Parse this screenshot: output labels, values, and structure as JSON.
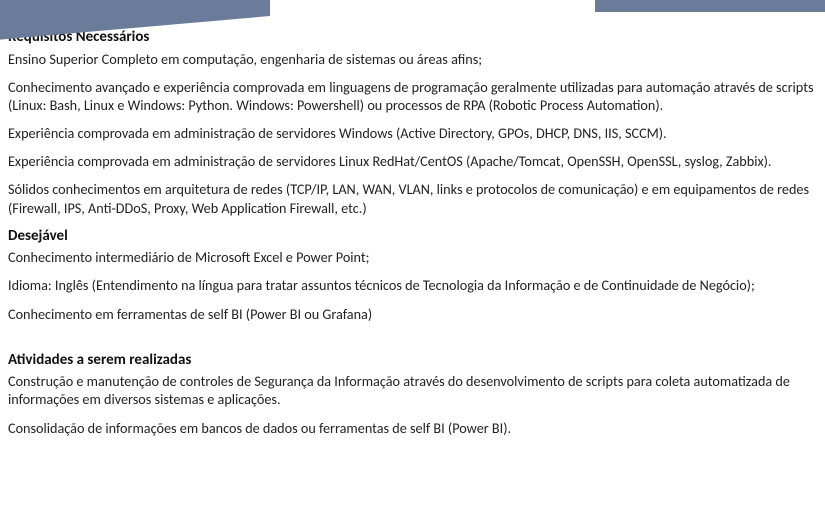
{
  "sections": {
    "necessary": {
      "title": "Requisitos Necessários",
      "items": [
        "Ensino Superior Completo em computação, engenharia de sistemas ou áreas afins;",
        "Conhecimento avançado e experiência comprovada em linguagens de programação geralmente utilizadas para automação através de scripts (Linux: Bash, Linux e Windows: Python. Windows: Powershell) ou processos de RPA (Robotic Process Automation).",
        "Experiência comprovada em administração de servidores Windows (Active Directory, GPOs, DHCP, DNS, IIS, SCCM).",
        "Experiência comprovada em administração de servidores Linux RedHat/CentOS (Apache/Tomcat, OpenSSH, OpenSSL, syslog, Zabbix).",
        "Sólidos conhecimentos em arquitetura de redes (TCP/IP, LAN, WAN, VLAN, links e protocolos de comunicação) e em equipamentos de redes (Firewall, IPS, Anti-DDoS, Proxy, Web Application Firewall, etc.)"
      ]
    },
    "desirable": {
      "title": "Desejável",
      "items": [
        "Conhecimento intermediário de Microsoft Excel e Power Point;",
        "Idioma: Inglês (Entendimento na língua para tratar assuntos técnicos de Tecnologia da Informação e de Continuidade de Negócio);",
        "Conhecimento em ferramentas de self BI (Power BI ou Grafana)"
      ]
    },
    "activities": {
      "title": "Atividades a serem realizadas",
      "items": [
        "Construção e manutenção de controles de Segurança da Informação através do desenvolvimento de scripts para coleta automatizada de informações em diversos sistemas e aplicações.",
        "Consolidação de informações em bancos de dados ou ferramentas de self BI (Power BI)."
      ]
    }
  }
}
